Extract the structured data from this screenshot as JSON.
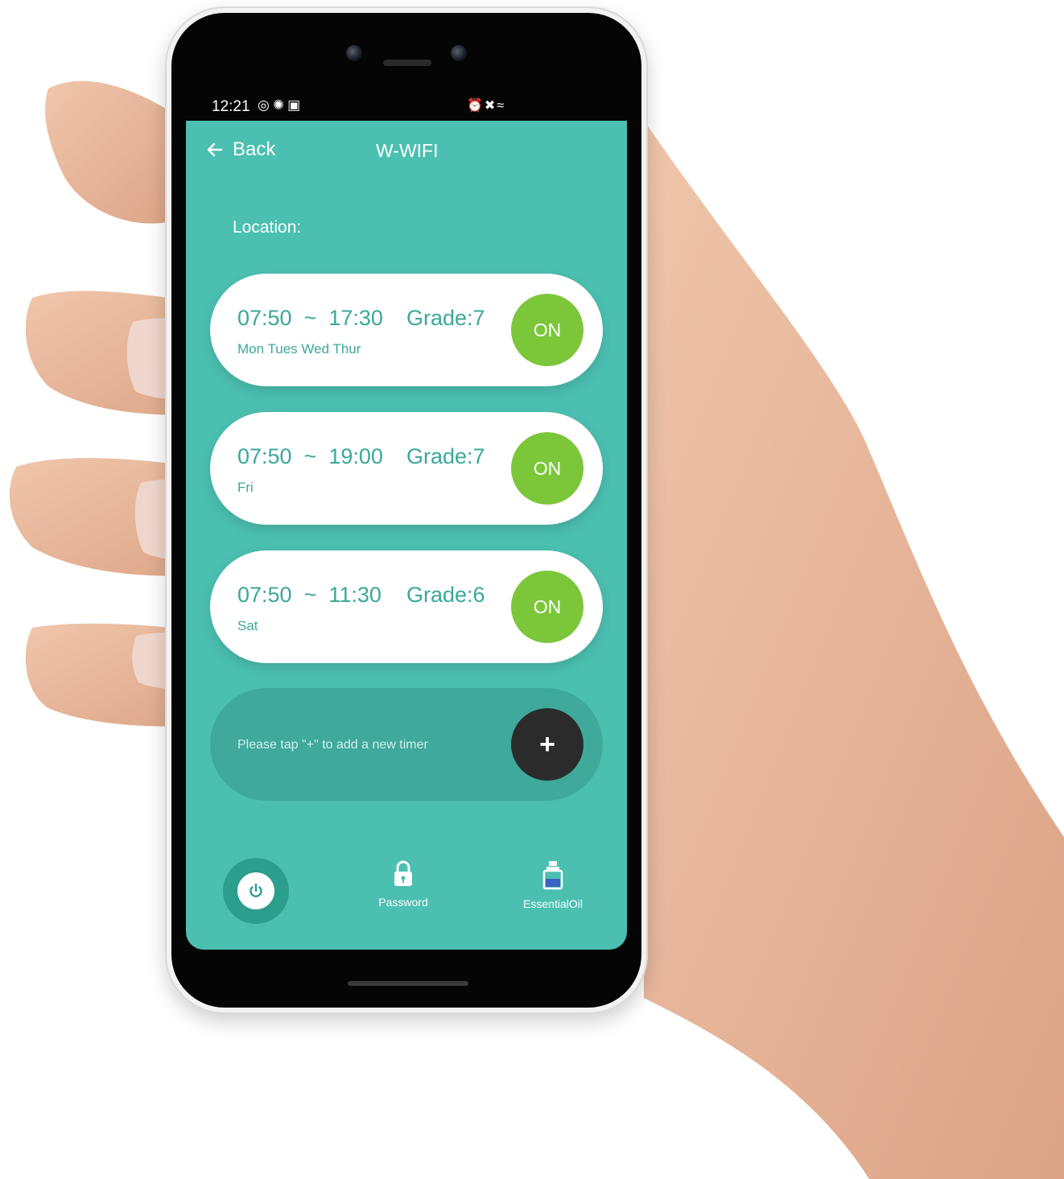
{
  "status_bar": {
    "time": "12:21",
    "left_icons": "◎✺▣",
    "right_icons": "⏰✖≈"
  },
  "header": {
    "back_label": "Back",
    "title": "W-WIFI"
  },
  "location_label": "Location:",
  "timers": [
    {
      "time": "07:50  ~  17:30",
      "grade": "Grade:7",
      "days": "Mon  Tues  Wed  Thur",
      "toggle": "ON"
    },
    {
      "time": "07:50  ~  19:00",
      "grade": "Grade:7",
      "days": "Fri",
      "toggle": "ON"
    },
    {
      "time": "07:50  ~  11:30",
      "grade": "Grade:6",
      "days": "Sat",
      "toggle": "ON"
    }
  ],
  "add_timer": {
    "hint": "Please tap \"+\" to add a new timer",
    "button": "+"
  },
  "bottom_nav": {
    "power_icon": "power-icon",
    "items": [
      {
        "label": "Password",
        "icon": "lock-icon"
      },
      {
        "label": "EssentialOil",
        "icon": "bottle-icon"
      }
    ]
  },
  "colors": {
    "screen_bg": "#4bbfb0",
    "accent_text": "#3aa898",
    "on_button": "#7cc63a",
    "add_button": "#2b2b2b"
  }
}
